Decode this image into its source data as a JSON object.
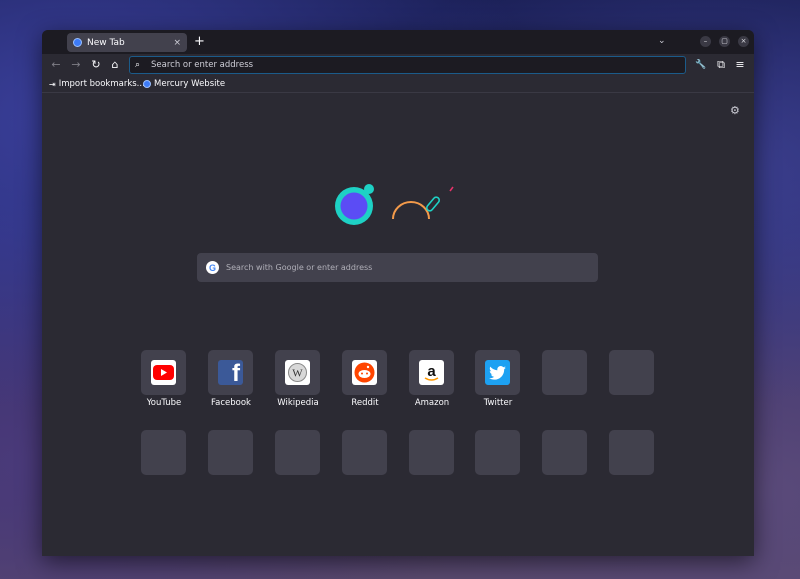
{
  "tab": {
    "title": "New Tab",
    "close": "×"
  },
  "tabbar": {
    "new_tab": "+",
    "list_tabs": "⌄"
  },
  "window_controls": {
    "minimize": "–",
    "maximize": "▢",
    "close": "×"
  },
  "nav": {
    "back": "←",
    "forward": "→",
    "reload": "↻",
    "home": "⌂",
    "url_placeholder": "Search or enter address",
    "search": "⌕",
    "tools": "🔧",
    "extensions": "⧉",
    "menu": "≡"
  },
  "bookmarks": [
    {
      "label": "Import bookmarks...",
      "icon": "import-icon"
    },
    {
      "label": "Mercury Website",
      "icon": "mercury-globe-icon"
    }
  ],
  "newtab": {
    "settings": "⚙",
    "search_placeholder": "Search with Google or enter address",
    "google_letter": "G",
    "shortcuts": [
      {
        "label": "YouTube",
        "icon": "youtube-icon"
      },
      {
        "label": "Facebook",
        "icon": "facebook-icon"
      },
      {
        "label": "Wikipedia",
        "icon": "wikipedia-icon"
      },
      {
        "label": "Reddit",
        "icon": "reddit-icon"
      },
      {
        "label": "Amazon",
        "icon": "amazon-icon"
      },
      {
        "label": "Twitter",
        "icon": "twitter-icon"
      }
    ],
    "empty_tiles": 10
  },
  "colors": {
    "accent": "#3d7bf7",
    "background": "#2b2a33",
    "tile": "#42414d",
    "logo_teal": "#1ed1c5",
    "logo_purple": "#5b4cf5",
    "logo_orange": "#f39a4a"
  }
}
